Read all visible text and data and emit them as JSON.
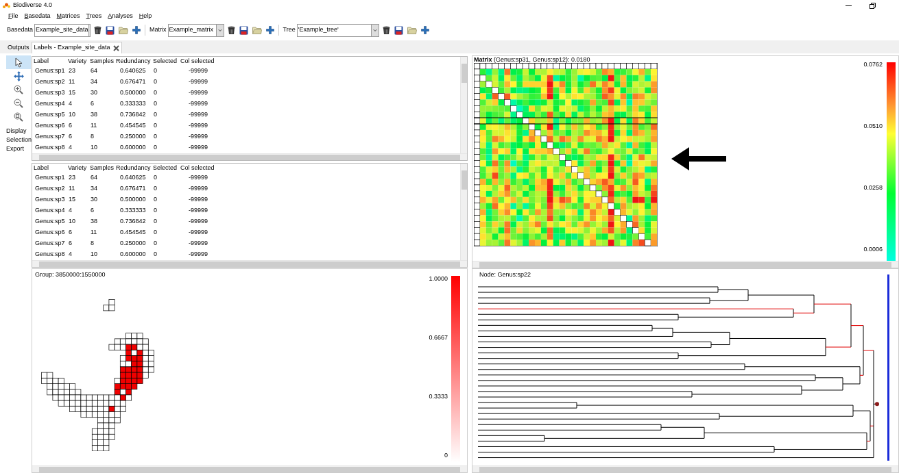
{
  "window": {
    "title": "Biodiverse 4.0"
  },
  "menu": [
    "File",
    "Basedata",
    "Matrices",
    "Trees",
    "Analyses",
    "Help"
  ],
  "toolbar": [
    {
      "label": "Basedata",
      "value": "Example_site_data"
    },
    {
      "label": "Matrix",
      "value": "Example_matrix"
    },
    {
      "label": "Tree",
      "value": "'Example_tree'"
    }
  ],
  "tabs": [
    {
      "label": "Outputs",
      "selected": false,
      "closable": false
    },
    {
      "label": "Labels - Example_site_data",
      "selected": true,
      "closable": true
    }
  ],
  "tools": [
    {
      "kind": "pointer",
      "selected": true
    },
    {
      "kind": "pan",
      "selected": false
    },
    {
      "kind": "zoom-in",
      "selected": false
    },
    {
      "kind": "zoom-out",
      "selected": false
    },
    {
      "kind": "zoom-fit",
      "selected": false
    }
  ],
  "tool_menus": [
    "Display",
    "Selection",
    "Export"
  ],
  "tables": [
    {
      "columns": [
        "Label",
        "Variety",
        "Samples",
        "Redundancy",
        "Selected",
        "Col selected"
      ],
      "rows": [
        [
          "Genus:sp1",
          "23",
          "64",
          "0.640625",
          "0",
          "-99999"
        ],
        [
          "Genus:sp2",
          "11",
          "34",
          "0.676471",
          "0",
          "-99999"
        ],
        [
          "Genus:sp3",
          "15",
          "30",
          "0.500000",
          "0",
          "-99999"
        ],
        [
          "Genus:sp4",
          "4",
          "6",
          "0.333333",
          "0",
          "-99999"
        ],
        [
          "Genus:sp5",
          "10",
          "38",
          "0.736842",
          "0",
          "-99999"
        ],
        [
          "Genus:sp6",
          "6",
          "11",
          "0.454545",
          "0",
          "-99999"
        ],
        [
          "Genus:sp7",
          "6",
          "8",
          "0.250000",
          "0",
          "-99999"
        ],
        [
          "Genus:sp8",
          "4",
          "10",
          "0.600000",
          "0",
          "-99999"
        ]
      ]
    },
    {
      "columns": [
        "Label",
        "Variety",
        "Samples",
        "Redundancy",
        "Selected",
        "Col selected"
      ],
      "rows": [
        [
          "Genus:sp1",
          "23",
          "64",
          "0.640625",
          "0",
          "-99999"
        ],
        [
          "Genus:sp2",
          "11",
          "34",
          "0.676471",
          "0",
          "-99999"
        ],
        [
          "Genus:sp3",
          "15",
          "30",
          "0.500000",
          "0",
          "-99999"
        ],
        [
          "Genus:sp4",
          "4",
          "6",
          "0.333333",
          "0",
          "-99999"
        ],
        [
          "Genus:sp5",
          "10",
          "38",
          "0.736842",
          "0",
          "-99999"
        ],
        [
          "Genus:sp6",
          "6",
          "11",
          "0.454545",
          "0",
          "-99999"
        ],
        [
          "Genus:sp7",
          "6",
          "8",
          "0.250000",
          "0",
          "-99999"
        ],
        [
          "Genus:sp8",
          "4",
          "10",
          "0.600000",
          "0",
          "-99999"
        ]
      ]
    }
  ],
  "matrix": {
    "title": "**Matrix** (Genus:sp31, Genus:sp12): 0.0180",
    "scale": [
      "0.0762",
      "0.0510",
      "0.0258",
      "0.0006"
    ]
  },
  "map": {
    "title": "Group: 3850000:1550000",
    "scale": [
      "1.0000",
      "0.6667",
      "0.3333",
      "0"
    ]
  },
  "tree": {
    "title": "Node: Genus:sp22"
  }
}
